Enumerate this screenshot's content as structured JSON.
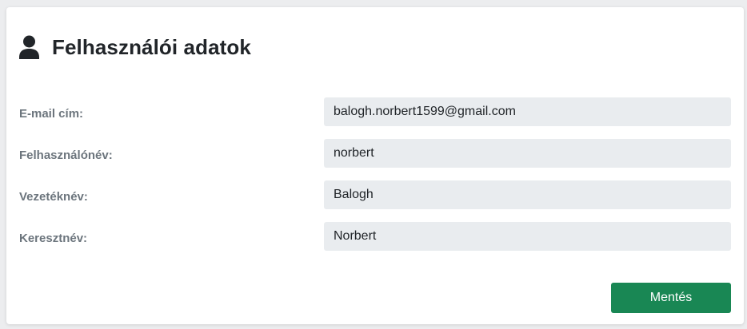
{
  "card": {
    "title": "Felhasználói adatok",
    "icon": "user-icon"
  },
  "fields": [
    {
      "label": "E-mail cím:",
      "value": "balogh.norbert1599@gmail.com"
    },
    {
      "label": "Felhasználónév:",
      "value": "norbert"
    },
    {
      "label": "Vezetéknév:",
      "value": "Balogh"
    },
    {
      "label": "Keresztnév:",
      "value": "Norbert"
    }
  ],
  "actions": {
    "save_label": "Mentés"
  },
  "colors": {
    "save_button": "#198754",
    "input_background": "#e9ecef",
    "label_text": "#6c757d"
  }
}
